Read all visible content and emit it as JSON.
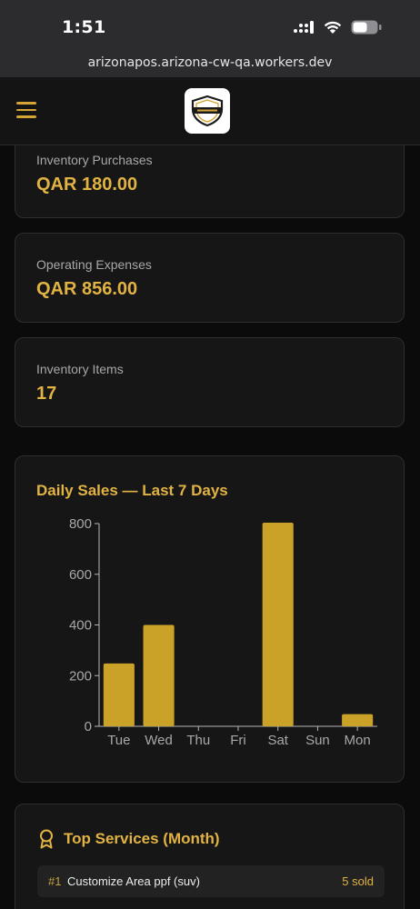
{
  "status_bar": {
    "time": "1:51"
  },
  "browser": {
    "url": "arizonapos.arizona-cw-qa.workers.dev"
  },
  "header": {
    "menu_icon": "hamburger-icon",
    "logo_icon": "shield-logo-icon",
    "accent_color": "#d4a534"
  },
  "stats": [
    {
      "label": "Inventory Purchases",
      "value": "QAR 180.00"
    },
    {
      "label": "Operating Expenses",
      "value": "QAR 856.00"
    },
    {
      "label": "Inventory Items",
      "value": "17"
    }
  ],
  "chart": {
    "title": "Daily Sales — Last 7 Days"
  },
  "chart_data": {
    "type": "bar",
    "categories": [
      "Tue",
      "Wed",
      "Thu",
      "Fri",
      "Sat",
      "Sun",
      "Mon"
    ],
    "values": [
      248,
      400,
      0,
      0,
      808,
      0,
      48
    ],
    "ylim": [
      0,
      800
    ],
    "yticks": [
      0,
      200,
      400,
      600,
      800
    ],
    "bar_color": "#c9a227",
    "grid": false
  },
  "services": {
    "title": "Top Services (Month)",
    "icon": "award-icon",
    "items": [
      {
        "rank": "#1",
        "name": "Customize Area ppf (suv)",
        "count": "5 sold"
      }
    ]
  }
}
